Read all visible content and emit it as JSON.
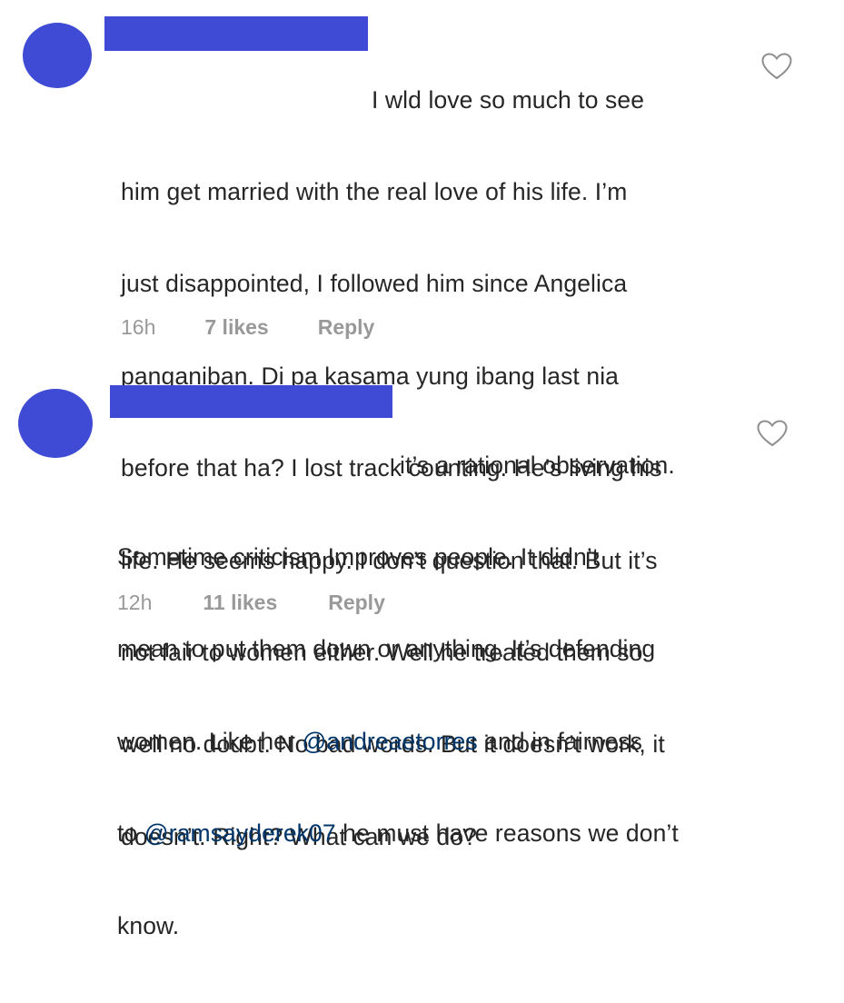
{
  "comments": [
    {
      "lines": [
        "I wld love so much to see",
        "him get married with the real love of his life. I’m",
        "just disappointed, I followed him since Angelica",
        "panganiban. Di pa kasama yung ibang last nia",
        "before that ha? I lost track counting. He’s living his",
        "life. He seems happy. I don’t question that. But it’s",
        "not fair to women either. Well he treated them so",
        "well no doubt. No bad words. But it doesn’t work, it",
        "doesn’t. Right? What can we do?"
      ],
      "time": "16h",
      "likes": "7 likes",
      "reply": "Reply",
      "like_icon": "heart-outline-icon"
    },
    {
      "lines": [
        "it’s a rational observation.",
        "Sometime criticism Improves people. It didn’t",
        "mean to put them down or anything. It’s defending"
      ],
      "line4_before": "women. Like her ",
      "mention1": "@andreaetorres",
      "line4_after": " and in fairness",
      "line5_before": "to ",
      "mention2": "@ramsayderek07",
      "line5_after": " he must have reasons we don’t",
      "line6": "know.",
      "time": "12h",
      "likes": "11 likes",
      "reply": "Reply",
      "like_icon": "heart-outline-icon"
    }
  ],
  "colors": {
    "avatar": "#3f4bd4",
    "redaction": "#3f4bd4",
    "text": "#262626",
    "meta": "#999999",
    "mention": "#003569",
    "heart_stroke": "#8e8e8e"
  }
}
